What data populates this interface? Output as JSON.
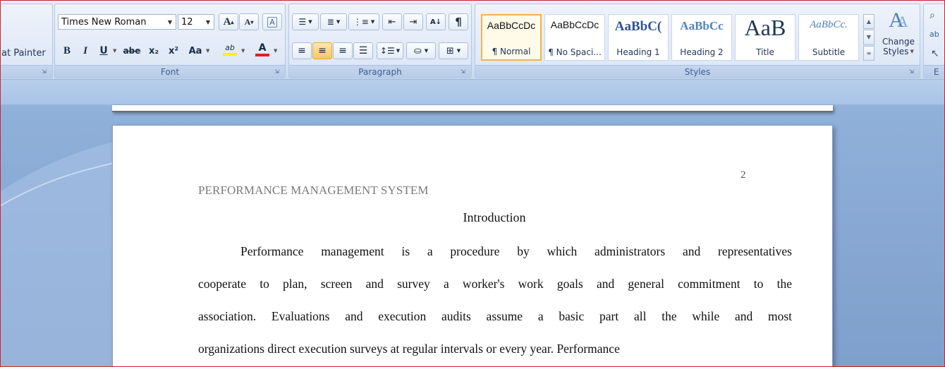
{
  "ribbon": {
    "clipboard": {
      "format_painter_label": "at Painter"
    },
    "font": {
      "group_label": "Font",
      "font_name": "Times New Roman",
      "font_size": "12",
      "grow_label": "A",
      "shrink_label": "A",
      "bold_label": "B",
      "italic_label": "I",
      "underline_label": "U",
      "strike_label": "abe",
      "subscript_label": "x₂",
      "superscript_label": "x²",
      "change_case_label": "Aa",
      "highlight_label": "ab",
      "font_color_label": "A",
      "clear_label": "A"
    },
    "paragraph": {
      "group_label": "Paragraph",
      "sort_label": "A↓",
      "show_marks_label": "¶"
    },
    "styles": {
      "group_label": "Styles",
      "tiles": [
        {
          "preview": "AaBbCcDc",
          "name": "¶ Normal"
        },
        {
          "preview": "AaBbCcDc",
          "name": "¶ No Spaci..."
        },
        {
          "preview": "AaBbC(",
          "name": "Heading 1"
        },
        {
          "preview": "AaBbCc",
          "name": "Heading 2"
        },
        {
          "preview": "AaB",
          "name": "Title"
        },
        {
          "preview": "AaBbCc.",
          "name": "Subtitle"
        }
      ],
      "change_styles_line1": "Change",
      "change_styles_line2": "Styles"
    },
    "editing": {
      "group_label": "E"
    },
    "colors": {
      "highlight": "#f7f300",
      "font_color": "#e02020",
      "selected_border": "#f0b44a"
    }
  },
  "document": {
    "page_number": "2",
    "running_head": "PERFORMANCE MANAGEMENT SYSTEM",
    "title": "Introduction",
    "lines": [
      "Performance management is a procedure by which administrators and representatives",
      "cooperate to plan, screen and survey a worker's work goals and general commitment to the",
      "association. Evaluations and execution audits assume a basic part all the while and most",
      "organizations direct execution surveys at regular intervals or every year. Performance"
    ]
  }
}
